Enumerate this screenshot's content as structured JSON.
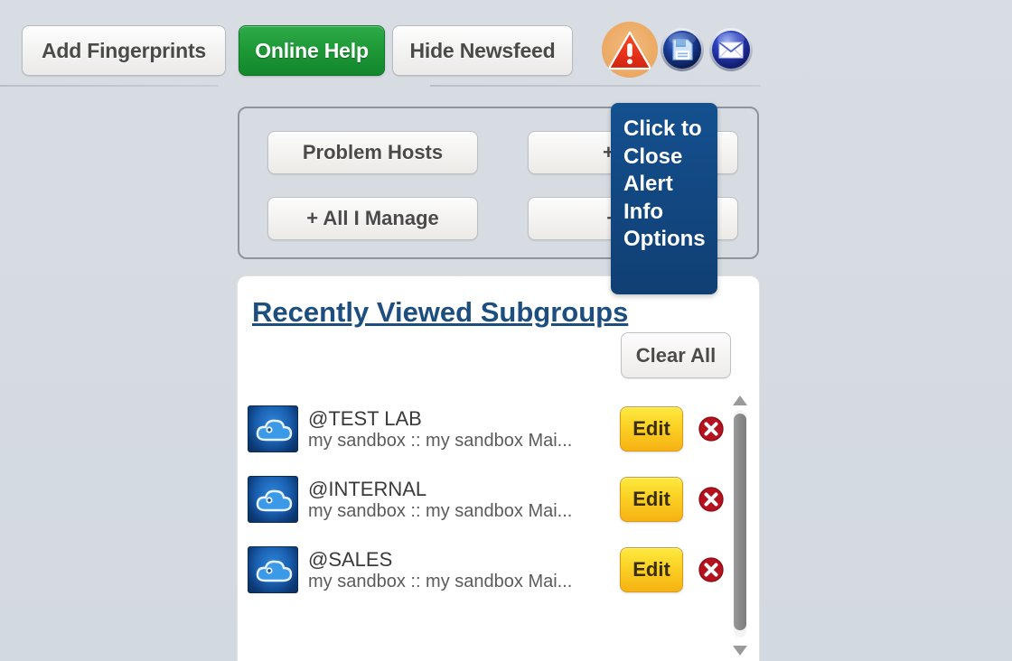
{
  "toolbar": {
    "buttons": [
      {
        "label": "Add Fingerprints",
        "name": "add-fingerprints"
      },
      {
        "label": "Online Help",
        "name": "online-help"
      },
      {
        "label": "Hide Newsfeed",
        "name": "hide-newsfeed"
      }
    ],
    "icons": [
      {
        "name": "alert-warning-icon",
        "title": "Alert"
      },
      {
        "name": "save-disk-icon",
        "title": "Save"
      },
      {
        "name": "mail-envelope-icon",
        "title": "Mail"
      }
    ]
  },
  "tooltip": {
    "text": "Click to Close Alert Info Options",
    "bg_color": "#124a86"
  },
  "filter_panel": {
    "buttons": [
      {
        "label": "Problem Hosts",
        "name": "problem-hosts"
      },
      {
        "label": "+ All S",
        "name": "all-switches"
      },
      {
        "label": "+ All I Manage",
        "name": "all-i-manage"
      },
      {
        "label": "+ All I",
        "name": "all-i-monitor"
      }
    ]
  },
  "recent_panel": {
    "title": "Recently Viewed Subgroups",
    "clear_all_label": "Clear All",
    "edit_label": "Edit",
    "rows": [
      {
        "name": "@TEST LAB",
        "subtitle": "my sandbox :: my sandbox Mai..."
      },
      {
        "name": "@INTERNAL",
        "subtitle": "my sandbox :: my sandbox Mai..."
      },
      {
        "name": "@SALES",
        "subtitle": "my sandbox :: my sandbox Mai..."
      }
    ]
  },
  "colors": {
    "page_bg": "#d3d9e0",
    "green_button": "#1f9a38",
    "tooltip_blue": "#124a86",
    "link_blue": "#1c4e80",
    "edit_yellow": "#fbd326",
    "delete_red": "#b4121f",
    "alert_orange": "#e79c4e",
    "alert_red": "#e8341c"
  }
}
